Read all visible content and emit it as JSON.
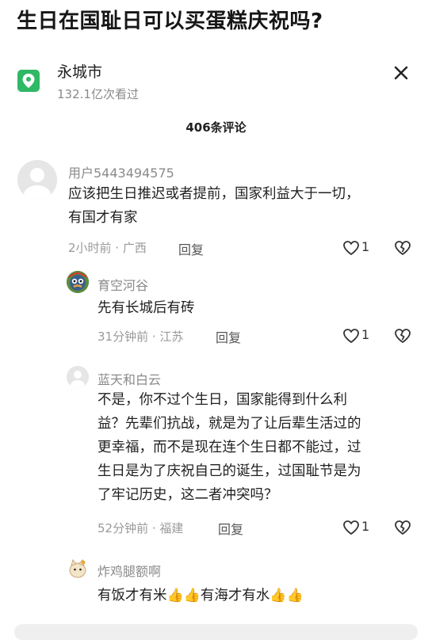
{
  "post": {
    "title": "生日在国耻日可以买蛋糕庆祝吗?"
  },
  "topic": {
    "name": "永城市",
    "views": "132.1亿次看过",
    "icon": "location-pin-icon",
    "close_icon": "close-icon"
  },
  "comments_header": {
    "count_label": "406条评论"
  },
  "comments": [
    {
      "username": "用户5443494575",
      "lines": [
        "应该把生日推迟或者提前，国家利益大于一切，",
        "有国才有家"
      ],
      "time": "2小时前",
      "region": "广西",
      "reply_label": "回复",
      "likes": "1"
    }
  ],
  "replies": [
    {
      "username": "育空河谷",
      "lines": [
        "先有长城后有砖"
      ],
      "time": "31分钟前",
      "region": "江苏",
      "reply_label": "回复",
      "likes": "1"
    },
    {
      "username": "蓝天和白云",
      "lines": [
        "不是，你不过个生日，国家能得到什么利",
        "益？先辈们抗战，就是为了让后辈生活过的",
        "更幸福，而不是现在连个生日都不能过，过",
        "生日是为了庆祝自己的诞生，过国耻节是为",
        "了牢记历史，这二者冲突吗？"
      ],
      "time": "52分钟前",
      "region": "福建",
      "reply_label": "回复",
      "likes": "1"
    },
    {
      "username": "炸鸡腿额啊",
      "text_a": "有饭才有米",
      "emoji_a": "👍👍",
      "text_b": "有海才有水",
      "emoji_b": "👍👍"
    }
  ],
  "separator": " · ",
  "colors": {
    "accent_green": "#2fb865",
    "meta_gray": "#9a9a9a"
  }
}
